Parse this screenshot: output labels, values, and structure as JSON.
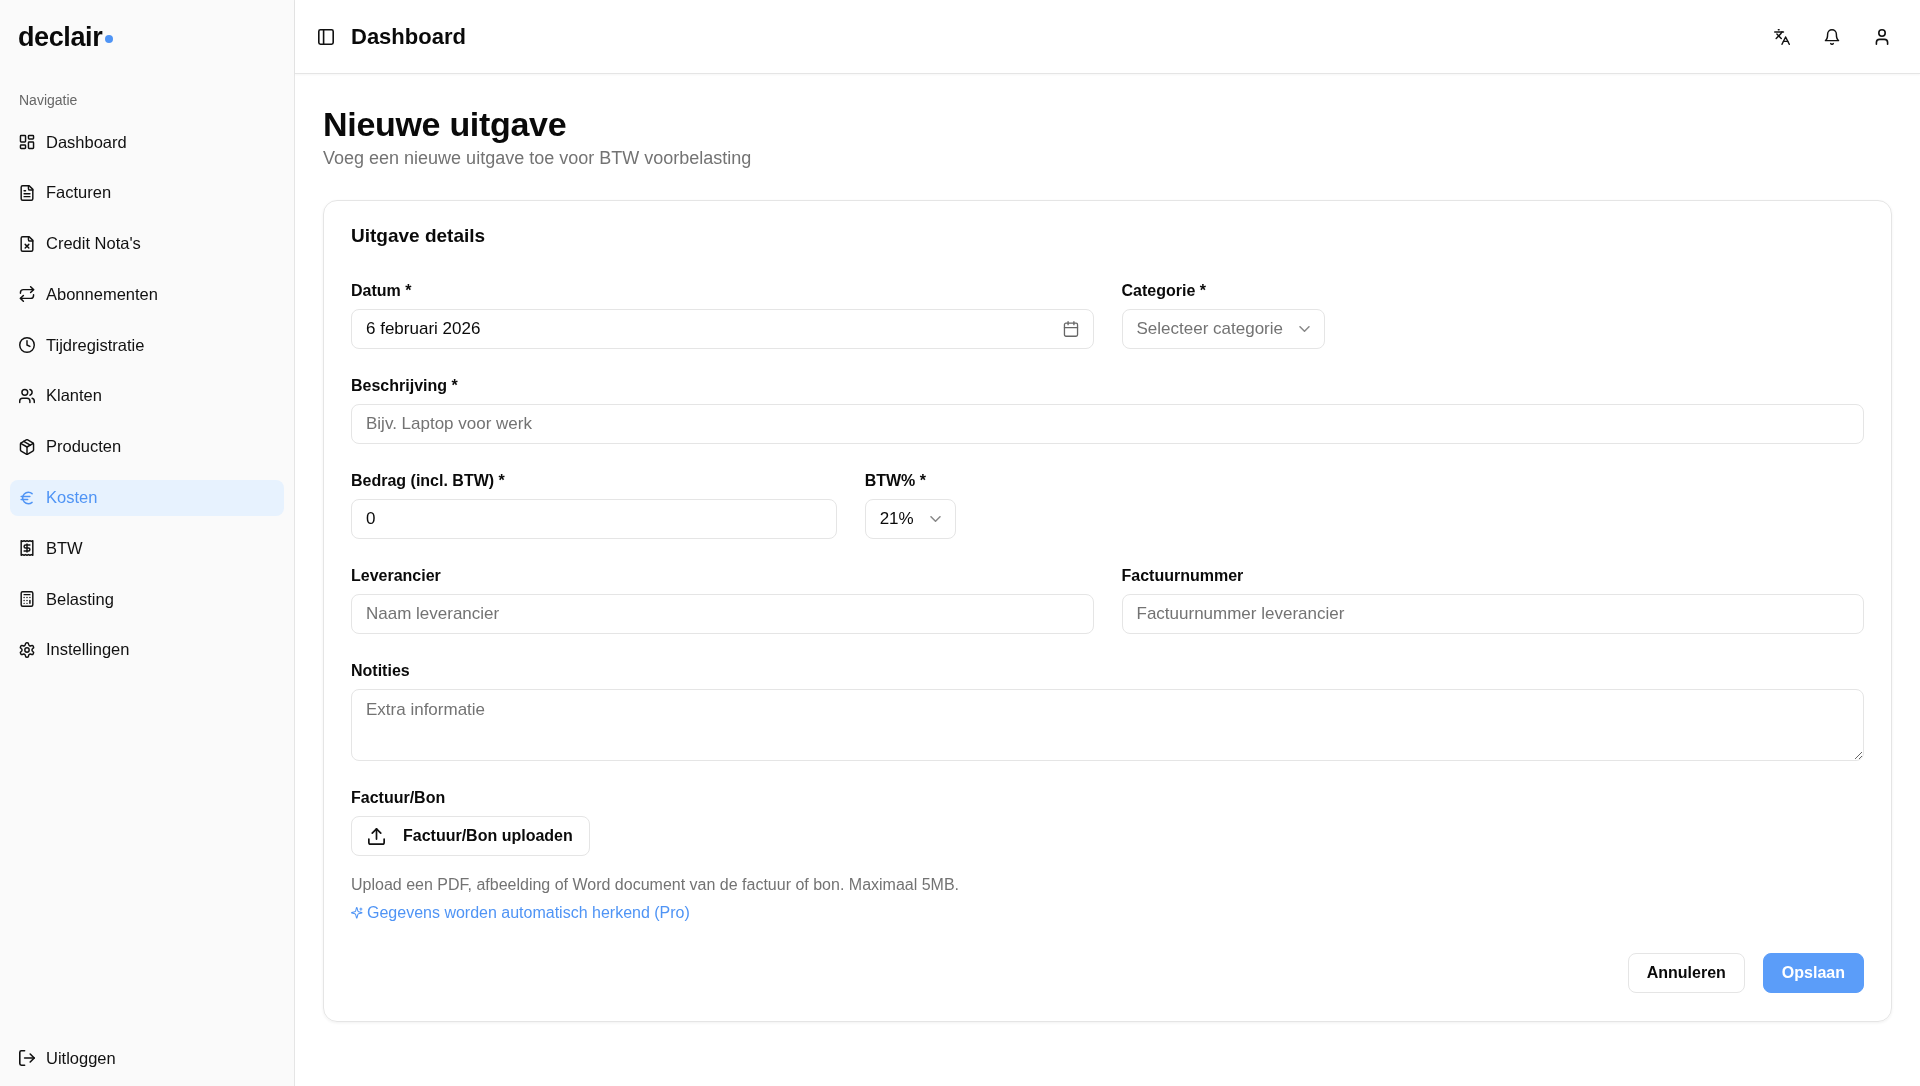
{
  "sidebar": {
    "logo": "declair",
    "section_label": "Navigatie",
    "items": [
      {
        "label": "Dashboard",
        "selected": false
      },
      {
        "label": "Facturen",
        "selected": false
      },
      {
        "label": "Credit Nota's",
        "selected": false
      },
      {
        "label": "Abonnementen",
        "selected": false
      },
      {
        "label": "Tijdregistratie",
        "selected": false
      },
      {
        "label": "Klanten",
        "selected": false
      },
      {
        "label": "Producten",
        "selected": false
      },
      {
        "label": "Kosten",
        "selected": true
      },
      {
        "label": "BTW",
        "selected": false
      },
      {
        "label": "Belasting",
        "selected": false
      },
      {
        "label": "Instellingen",
        "selected": false
      }
    ],
    "logout": "Uitloggen"
  },
  "topbar": {
    "title": "Dashboard"
  },
  "page": {
    "title": "Nieuwe uitgave",
    "subtitle": "Voeg een nieuwe uitgave toe voor BTW voorbelasting"
  },
  "form": {
    "title": "Uitgave details",
    "rows": [
      {
        "fields": [
          {
            "kind": "date",
            "label": "Datum *",
            "value": "6 februari 2026"
          },
          {
            "kind": "select",
            "label": "Categorie *",
            "placeholder": "Selecteer categorie"
          }
        ]
      },
      {
        "fields": [
          {
            "kind": "text",
            "label": "Beschrijving *",
            "placeholder": "Bijv. Laptop voor werk"
          }
        ]
      },
      {
        "fields": [
          {
            "kind": "text",
            "label": "Bedrag (incl. BTW) *",
            "value": "0"
          },
          {
            "kind": "select",
            "label": "BTW% *",
            "value": "21%"
          }
        ]
      },
      {
        "fields": [
          {
            "kind": "text",
            "label": "Leverancier",
            "placeholder": "Naam leverancier"
          },
          {
            "kind": "text",
            "label": "Factuurnummer",
            "placeholder": "Factuurnummer leverancier"
          }
        ]
      },
      {
        "fields": [
          {
            "kind": "textarea",
            "label": "Notities",
            "placeholder": "Extra informatie"
          }
        ]
      },
      {
        "fields": [
          {
            "kind": "file",
            "label": "Factuur/Bon",
            "button": "Factuur/Bon uploaden"
          }
        ]
      }
    ],
    "hint": "Upload een PDF, afbeelding of Word document van de factuur of bon. Maximaal 5MB.",
    "ai_note": "Gegevens worden automatisch herkend (Pro)",
    "actions": [
      {
        "label": "Annuleren",
        "kind": "secondary"
      },
      {
        "label": "Opslaan",
        "kind": "primary"
      }
    ]
  }
}
